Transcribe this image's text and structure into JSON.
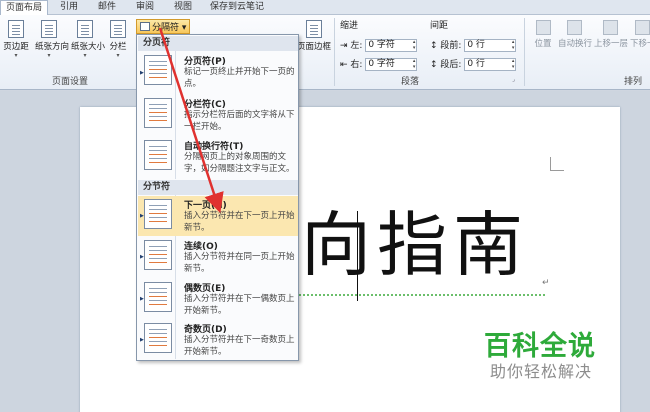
{
  "tabs": [
    "页面布局",
    "引用",
    "邮件",
    "审阅",
    "视图",
    "保存到云笔记"
  ],
  "page_setup": {
    "margins": "页边距",
    "orientation": "纸张方向",
    "size": "纸张大小",
    "columns": "分栏",
    "group_label": "页面设置",
    "breaks_button": "分隔符"
  },
  "page_bg": {
    "page_border": "页面边框"
  },
  "paragraph": {
    "indent_label": "缩进",
    "spacing_label": "间距",
    "left_label": "左:",
    "right_label": "右:",
    "before_label": "段前:",
    "after_label": "段后:",
    "left_value": "0 字符",
    "right_value": "0 字符",
    "before_value": "0 行",
    "after_value": "0 行",
    "group_label": "段落"
  },
  "arrange": {
    "position": "位置",
    "wrap": "自动换行",
    "forward": "上移一层",
    "backward": "下移一",
    "group_label": "排列"
  },
  "menu": {
    "page_breaks_header": "分页符",
    "section_breaks_header": "分节符",
    "items": [
      {
        "title": "分页符(P)",
        "desc": "标记一页终止并开始下一页的点。"
      },
      {
        "title": "分栏符(C)",
        "desc": "指示分栏符后面的文字将从下一栏开始。"
      },
      {
        "title": "自动换行符(T)",
        "desc": "分隔网页上的对象周围的文字，如分隔题注文字与正文。"
      },
      {
        "title": "下一页(N)",
        "desc": "插入分节符并在下一页上开始新节。"
      },
      {
        "title": "连续(O)",
        "desc": "插入分节符并在同一页上开始新节。"
      },
      {
        "title": "偶数页(E)",
        "desc": "插入分节符并在下一偶数页上开始新节。"
      },
      {
        "title": "奇数页(D)",
        "desc": "插入分节符并在下一奇数页上开始新节。"
      }
    ]
  },
  "document": {
    "text": "南指向指南",
    "visible_text": "向指南",
    "para_mark": "↵"
  },
  "watermark": {
    "line1": "百科全说",
    "line2": "助你轻松解决"
  },
  "colors": {
    "annotation_arrow": "#e0312f",
    "watermark_green": "#2eaa3a",
    "menu_highlight": "#fbe7b0"
  }
}
